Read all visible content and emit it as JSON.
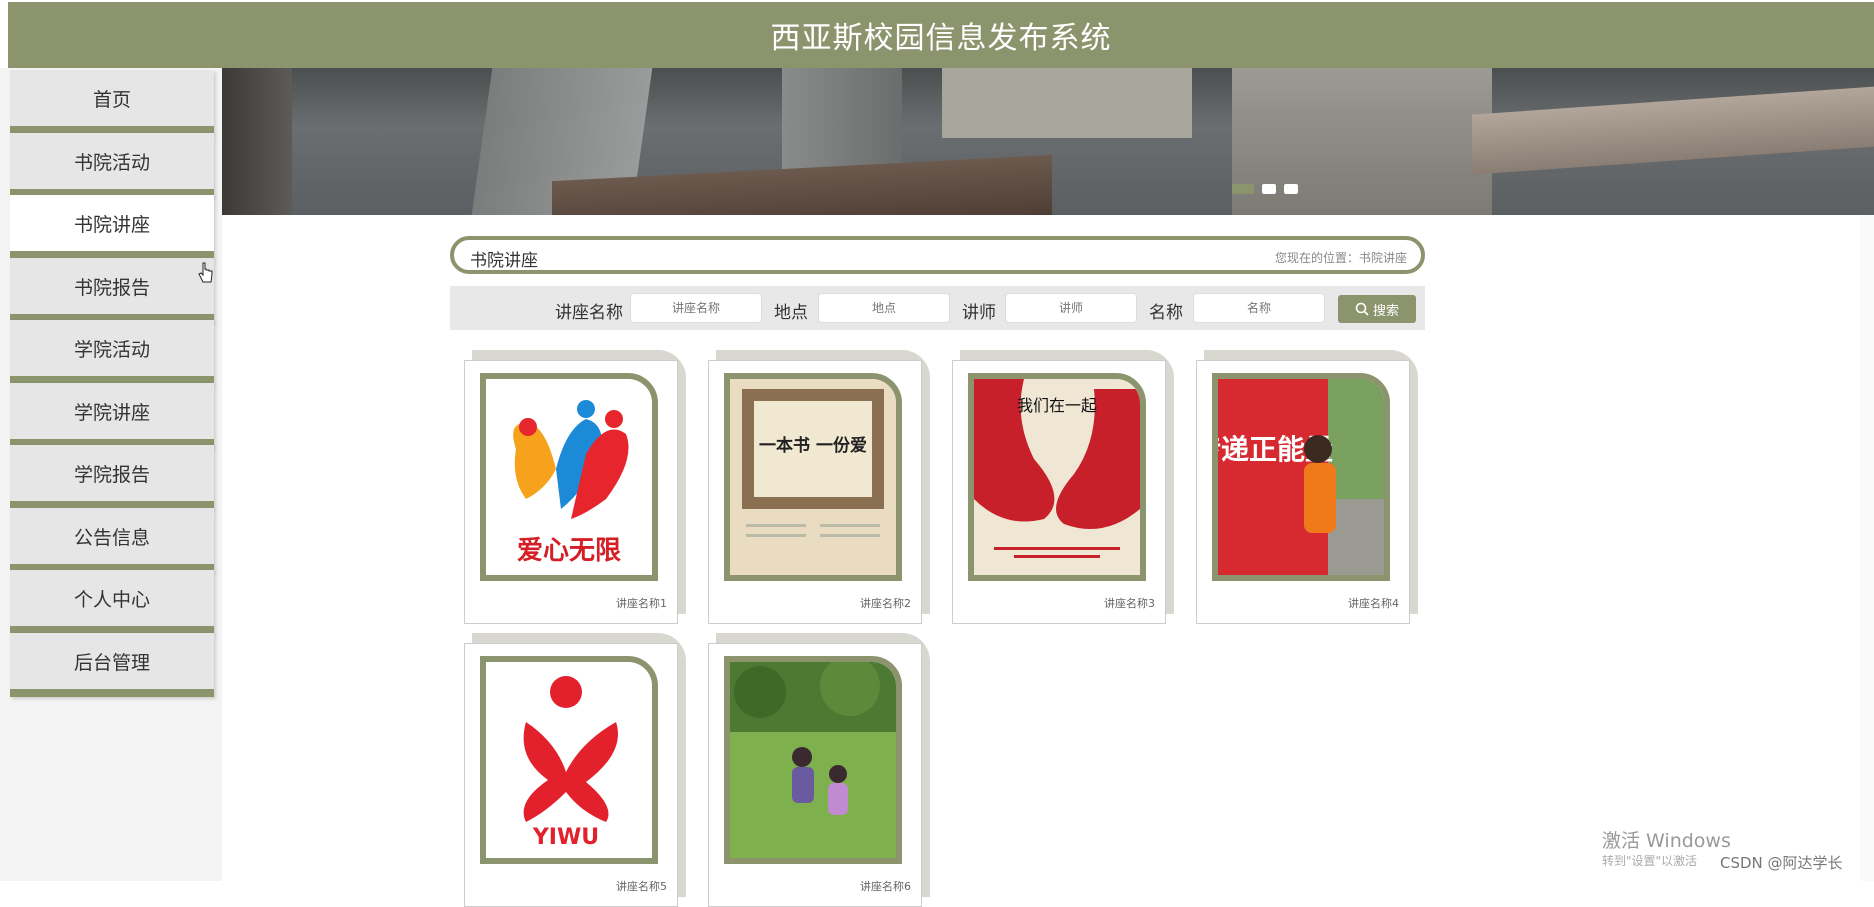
{
  "header": {
    "title": "西亚斯校园信息发布系统"
  },
  "sidebar": {
    "items": [
      {
        "label": "首页"
      },
      {
        "label": "书院活动"
      },
      {
        "label": "书院讲座"
      },
      {
        "label": "书院报告"
      },
      {
        "label": "学院活动"
      },
      {
        "label": "学院讲座"
      },
      {
        "label": "学院报告"
      },
      {
        "label": "公告信息"
      },
      {
        "label": "个人中心"
      },
      {
        "label": "后台管理"
      }
    ],
    "active": "书院讲座"
  },
  "section": {
    "title": "书院讲座",
    "location": "您现在的位置：书院讲座"
  },
  "search": {
    "name_label": "讲座名称",
    "name_placeholder": "讲座名称",
    "place_label": "地点",
    "place_placeholder": "地点",
    "teacher_label": "讲师",
    "teacher_placeholder": "讲师",
    "title_label": "名称",
    "title_placeholder": "名称",
    "button_label": "搜索"
  },
  "cards": [
    {
      "label": "讲座名称1",
      "image_text": "爱心无限"
    },
    {
      "label": "讲座名称2",
      "image_text": "一本书 一份爱"
    },
    {
      "label": "讲座名称3",
      "image_text": "我们在一起"
    },
    {
      "label": "讲座名称4",
      "image_text": "传递正能量"
    },
    {
      "label": "讲座名称5",
      "image_text": "YIWU"
    },
    {
      "label": "讲座名称6",
      "image_text": ""
    }
  ],
  "watermark": {
    "line1": "激活 Windows",
    "line2": "转到\"设置\"以激活",
    "csdn": "CSDN @阿达学长"
  },
  "colors": {
    "accent": "#8c946e",
    "sidebar_bg": "#f3f3f3"
  }
}
